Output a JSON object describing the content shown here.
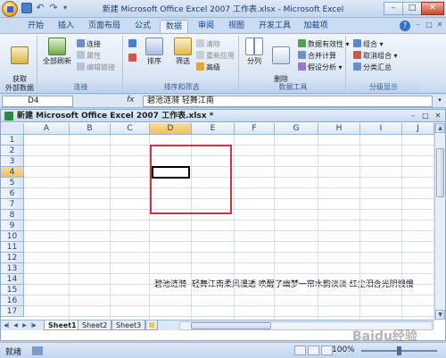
{
  "window": {
    "title": "新建 Microsoft Office Excel 2007 工作表.xlsx - Microsoft Excel"
  },
  "ribbon": {
    "tabs": [
      "开始",
      "插入",
      "页面布局",
      "公式",
      "数据",
      "审阅",
      "视图",
      "开发工具",
      "加载项"
    ],
    "active_tab": "数据",
    "groups": {
      "get_external": {
        "button": "获取\n外部数据"
      },
      "connections": {
        "label": "连接",
        "refresh_all": "全部刷新",
        "items": [
          "连接",
          "属性",
          "编辑链接"
        ]
      },
      "sort_filter": {
        "label": "排序和筛选",
        "sort": "排序",
        "filter": "筛选",
        "items": [
          "清除",
          "重新应用",
          "高级"
        ]
      },
      "data_tools": {
        "label": "数据工具",
        "split": "分列",
        "remove_dup": "删除\n重复项",
        "items": [
          "数据有效性",
          "合并计算",
          "假设分析"
        ]
      },
      "outline": {
        "label": "分级显示",
        "items": [
          "组合",
          "取消组合",
          "分类汇总"
        ]
      }
    }
  },
  "formula_bar": {
    "name_box": "D4",
    "fx": "fx",
    "value": "碧池涟漪  轻舞江南"
  },
  "workbook": {
    "title": "新建 Microsoft Office Excel 2007 工作表.xlsx *",
    "columns": [
      "A",
      "B",
      "C",
      "D",
      "E",
      "F",
      "G",
      "H",
      "I",
      "J"
    ],
    "selected_column": "D",
    "rows": [
      "1",
      "2",
      "3",
      "4",
      "5",
      "6",
      "7",
      "8",
      "9",
      "10",
      "11",
      "12",
      "13",
      "14",
      "15",
      "16",
      "17"
    ],
    "selected_row": "4",
    "cell_d4": "碧池涟漪",
    "row4_overflow": "轻舞江南柔风漫透 唤醒了幽梦一帘水韵淡淡 红尘泪含光阴慢慢",
    "sheets": [
      "Sheet1",
      "Sheet2",
      "Sheet3"
    ],
    "active_sheet": "Sheet1"
  },
  "status_bar": {
    "ready": "就绪",
    "zoom": "100%"
  },
  "watermark": "Baidu经验",
  "colors": {
    "accent": "#15428b",
    "highlight_box": "#d1343b",
    "header_selected": "#f1c15f"
  }
}
